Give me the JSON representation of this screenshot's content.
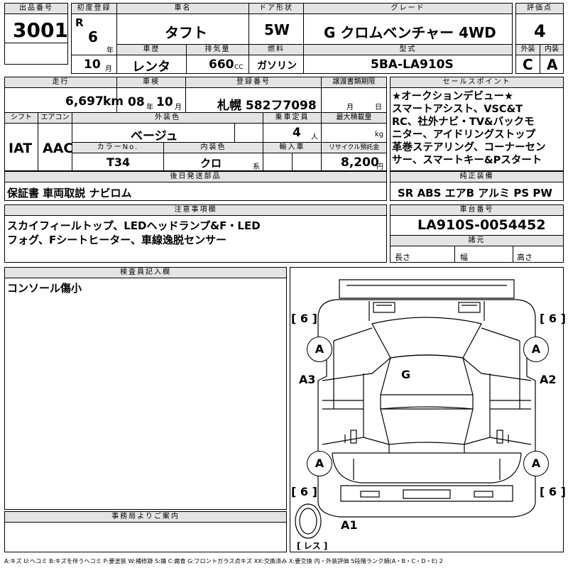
{
  "top": {
    "lot_label": "出品番号",
    "lot_value": "3001",
    "first_reg_label": "初度登録",
    "era": "R",
    "year": "6",
    "year_unit": "年",
    "month": "10",
    "month_unit": "月",
    "car_name_label": "車名",
    "car_name": "タフト",
    "door_label": "ドア形状",
    "door": "5W",
    "grade_label": "グレード",
    "grade": "G クロムベンチャー 4WD",
    "score_label": "評価点",
    "score": "4",
    "history_label": "車歴",
    "history": "レンタ",
    "displacement_label": "排気量",
    "displacement": "660",
    "displacement_unit": "CC",
    "fuel_label": "燃料",
    "fuel": "ガソリン",
    "model_label": "型式",
    "model": "5BA-LA910S",
    "exterior_label": "外装",
    "exterior": "C",
    "interior_label": "内装",
    "interior": "A"
  },
  "mid": {
    "mileage_label": "走行",
    "mileage": "6,697",
    "mileage_unit": "km",
    "inspection_label": "車検",
    "inspection_year": "08",
    "inspection_year_unit": "年",
    "inspection_month": "10",
    "inspection_month_unit": "月",
    "plate_label": "登録番号",
    "plate": "札幌 582フ7098",
    "transfer_label": "譲渡書類期限",
    "transfer_month_unit": "月",
    "transfer_day_unit": "日",
    "shift_label": "シフト",
    "shift": "IAT",
    "ac_label": "エアコン",
    "ac": "AAC",
    "color_label": "外装色",
    "color": "ベージュ",
    "capacity_label": "乗車定員",
    "capacity": "4",
    "capacity_unit": "人",
    "load_label": "最大積載量",
    "load_unit": "kg",
    "color_no_label": "カラーNo.",
    "color_no": "T34",
    "int_color_label": "内装色",
    "int_color": "クロ",
    "int_color_unit": "系",
    "import_label": "輸入車",
    "recycle_label": "リサイクル預託金",
    "recycle": "8,200",
    "recycle_unit": "円"
  },
  "sales_points": {
    "label": "セールスポイント",
    "lines": [
      "★オークションデビュー★",
      "スマートアシスト、VSC&T",
      "RC、社外ナビ・TV&バックモ",
      "ニター、アイドリングストップ",
      "革巻ステアリング、コーナーセン",
      "サー、スマートキー&Pスタート"
    ]
  },
  "later_parts": {
    "label": "後日発送部品",
    "value": "保証書 車両取説 ナビロム"
  },
  "genuine": {
    "label": "純正装備",
    "value": "SR ABS エアB アルミ PS PW"
  },
  "notes": {
    "label": "注意事項欄",
    "lines": [
      "スカイフィールトップ、LEDヘッドランプ&F・LED",
      "フォグ、Fシートヒーター、車線逸脱センサー"
    ]
  },
  "chassis": {
    "label": "車台番号",
    "value": "LA910S-0054452",
    "spec_label": "諸元",
    "length": "長さ",
    "width": "幅",
    "height": "高さ"
  },
  "inspector": {
    "label": "検査員記入欄",
    "value": "コンソール傷小"
  },
  "office": {
    "label": "事務局よりご案内"
  },
  "diagram": {
    "fl_bracket": "[ 6 ]",
    "fr_bracket": "[ 6 ]",
    "rl_bracket": "[ 6 ]",
    "rr_bracket": "[ 6 ]",
    "tire_fl": "A",
    "tire_fr": "A",
    "tire_rl": "A",
    "tire_rr": "A",
    "left_mark": "A3",
    "right_mark": "A2",
    "roof_mark": "G",
    "bottom_mark": "A1",
    "spare_label": "[ レス ]"
  },
  "legend": "A:キズ U:ヘコミ B:キズを伴うヘコミ P:要塗装 W:補修跡 S:錆 C:腐食 G:フロントガラス点キズ XX:交換済み X:要交換 内・外装評価 5段階ランク順(A・B・C・D・E) 2"
}
